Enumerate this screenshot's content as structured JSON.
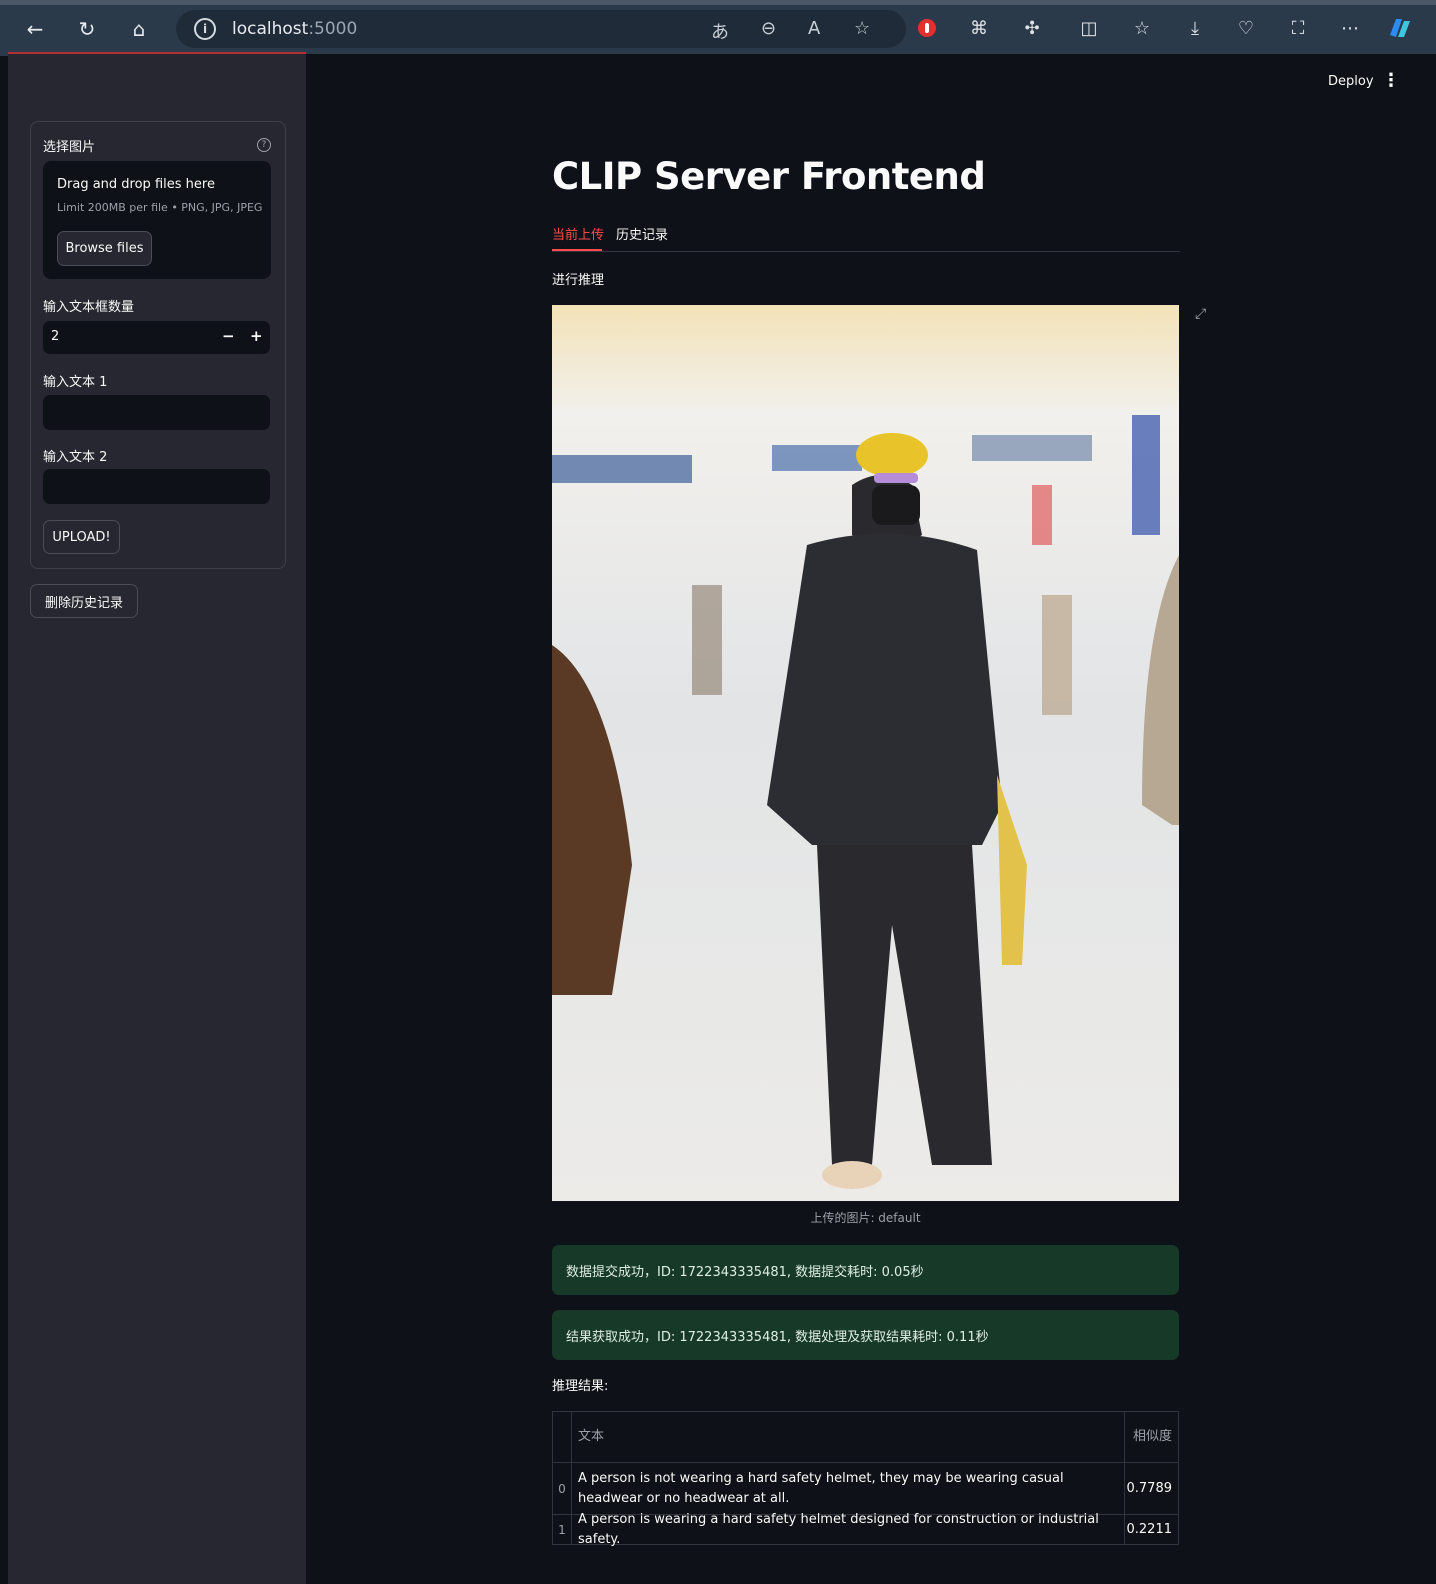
{
  "browser": {
    "url_host": "localhost",
    "url_port": ":5000"
  },
  "toolbar": {
    "deploy_label": "Deploy",
    "menu_icon": "⋮"
  },
  "sidebar": {
    "uploader_label": "选择图片",
    "dropzone_title": "Drag and drop files here",
    "dropzone_sub": "Limit 200MB per file • PNG, JPG, JPEG",
    "browse_label": "Browse files",
    "count_label": "输入文本框数量",
    "count_value": "2",
    "text1_label": "输入文本 1",
    "text2_label": "输入文本 2",
    "upload_label": "UPLOAD!",
    "delete_history_label": "删除历史记录"
  },
  "main": {
    "title": "CLIP Server Frontend",
    "tabs": [
      {
        "label": "当前上传",
        "active": true
      },
      {
        "label": "历史记录",
        "active": false
      }
    ],
    "section_label": "进行推理",
    "image_caption": "上传的图片: default",
    "alerts": [
      "数据提交成功，ID: 1722343335481, 数据提交耗时: 0.05秒",
      "结果获取成功，ID: 1722343335481, 数据处理及获取结果耗时: 0.11秒"
    ],
    "result_label": "推理结果:",
    "table": {
      "headers": [
        "文本",
        "相似度"
      ],
      "rows": [
        {
          "idx": "0",
          "text": "A person is not wearing a hard safety helmet, they may be wearing casual headwear or no headwear at all.",
          "score": "0.7789"
        },
        {
          "idx": "1",
          "text": "A person is wearing a hard safety helmet designed for construction or industrial safety.",
          "score": "0.2211"
        }
      ]
    }
  },
  "colors": {
    "accent": "#ff4b4b",
    "success_bg": "#173928",
    "sidebar_bg": "#262730",
    "main_bg": "#0e1117"
  }
}
